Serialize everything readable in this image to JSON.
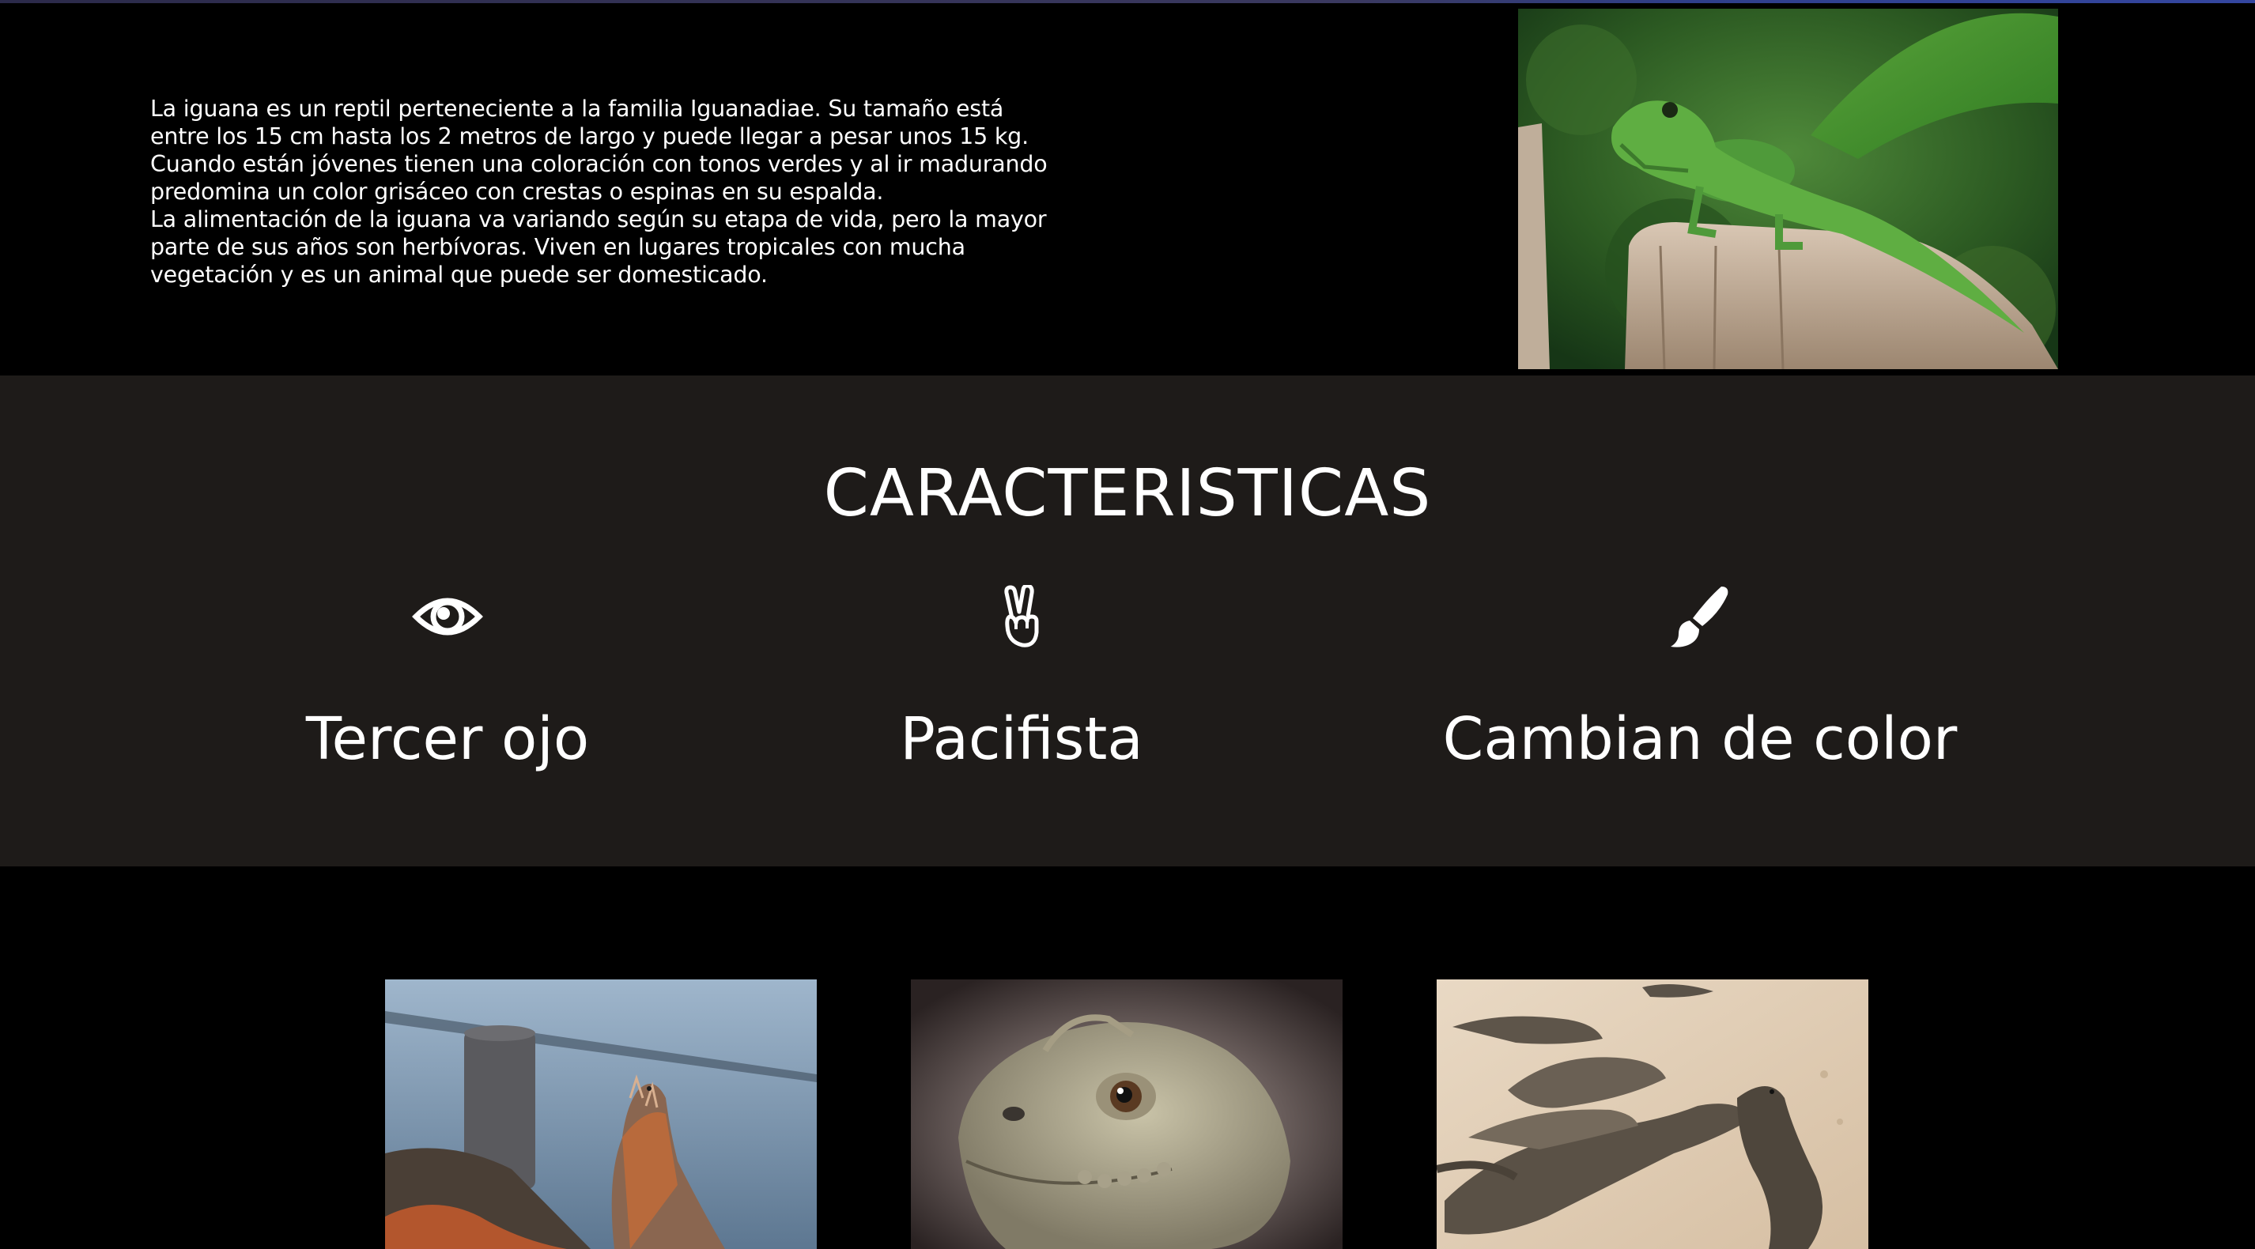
{
  "intro": {
    "paragraphs": [
      "La iguana es un reptil perteneciente a la familia Iguanadiae. Su tamaño está entre los 15 cm hasta los 2 metros de largo y puede llegar a pesar unos 15 kg. Cuando están jóvenes tienen una coloración con tonos verdes y al ir madurando predomina un color grisáceo con crestas o espinas en su espalda.",
      "La alimentación de la iguana va variando según su etapa de vida, pero la mayor parte de sus años son herbívoras. Viven en lugares tropicales con mucha vegetación y es un animal que puede ser domesticado."
    ],
    "photo_icon": "green-iguana-photo"
  },
  "features": {
    "title": "CARACTERISTICAS",
    "items": [
      {
        "icon": "eye-icon",
        "label": "Tercer ojo"
      },
      {
        "icon": "peace-hand-icon",
        "label": "Pacifista"
      },
      {
        "icon": "paint-brush-icon",
        "label": "Cambian de color"
      }
    ]
  },
  "gallery": {
    "photos": [
      "iguana-by-water-photo",
      "iguana-head-closeup-photo",
      "iguanas-on-sand-photo"
    ]
  },
  "colors": {
    "page_background": "#000000",
    "features_background": "#1e1b19",
    "text": "#ffffff"
  }
}
